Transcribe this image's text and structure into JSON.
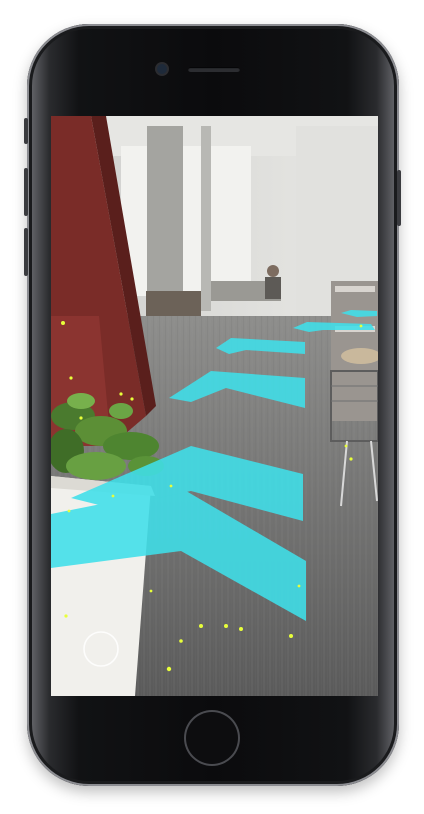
{
  "device": {
    "model_icon": "iphone-frame",
    "body_color": "#0b0b0d"
  },
  "ar_scene": {
    "description_icon": "ar-navigation-view",
    "arrow_color": "#3fe0ea",
    "particle_color": "#e8ff3a",
    "arrows_count": 5,
    "pointer_direction": "forward"
  }
}
